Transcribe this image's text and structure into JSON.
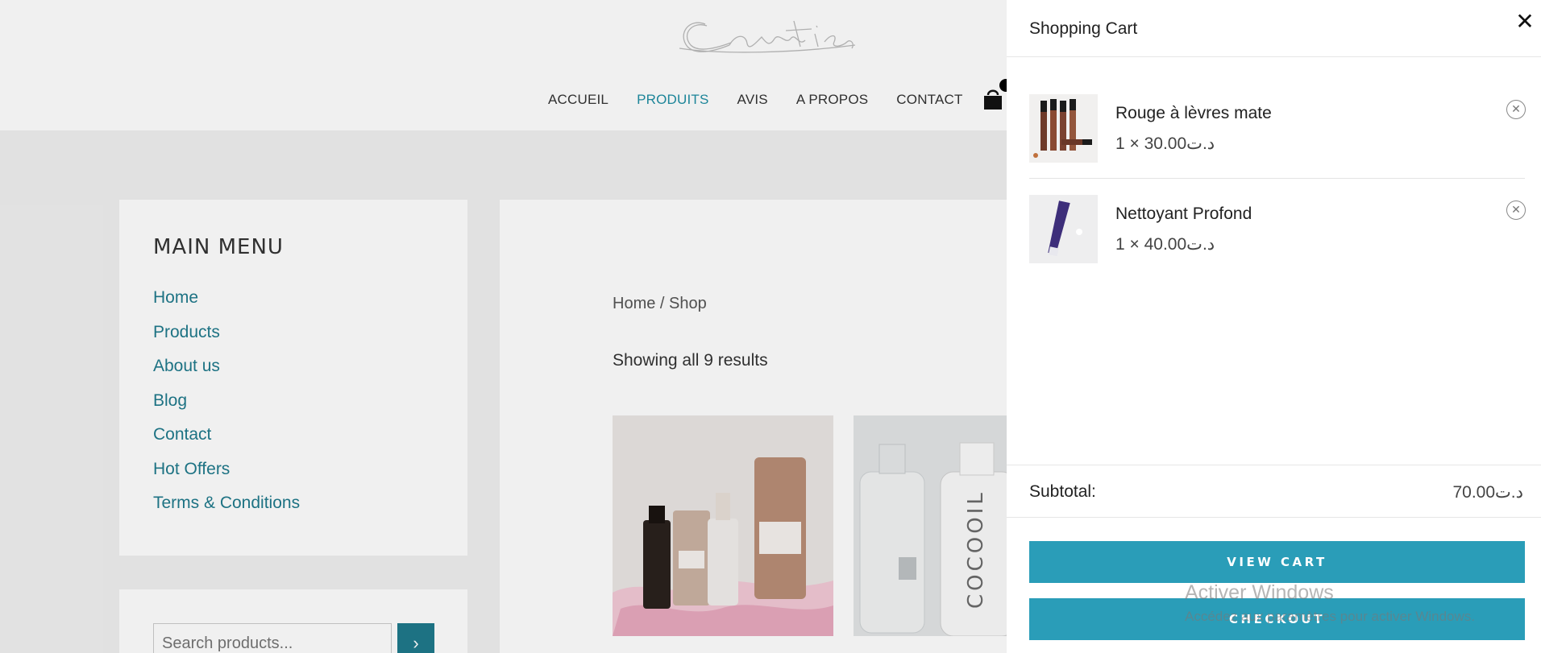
{
  "nav": {
    "items": [
      "ACCUEIL",
      "PRODUITS",
      "AVIS",
      "A PROPOS",
      "CONTACT"
    ],
    "active": "PRODUITS",
    "accent": "#1f8ea3"
  },
  "sidebar": {
    "title": "MAIN MENU",
    "items": [
      "Home",
      "Products",
      "About us",
      "Blog",
      "Contact",
      "Hot Offers",
      "Terms & Conditions"
    ],
    "search_placeholder": "Search products..."
  },
  "content": {
    "breadcrumb": "Home / Shop",
    "result_count": "Showing all 9 results"
  },
  "cart": {
    "title": "Shopping Cart",
    "items": [
      {
        "name": "Rouge à lèvres mate",
        "price": "1 × 30.00د.ت"
      },
      {
        "name": "Nettoyant Profond",
        "price": "1 × 40.00د.ت"
      }
    ],
    "subtotal_label": "Subtotal:",
    "subtotal_value": "70.00د.ت",
    "view_cart": "VIEW CART",
    "checkout": "CHECKOUT",
    "button_color": "#2a9db8"
  },
  "watermark": {
    "title": "Activer Windows",
    "subtitle": "Accédez aux paramètres pour activer Windows."
  }
}
